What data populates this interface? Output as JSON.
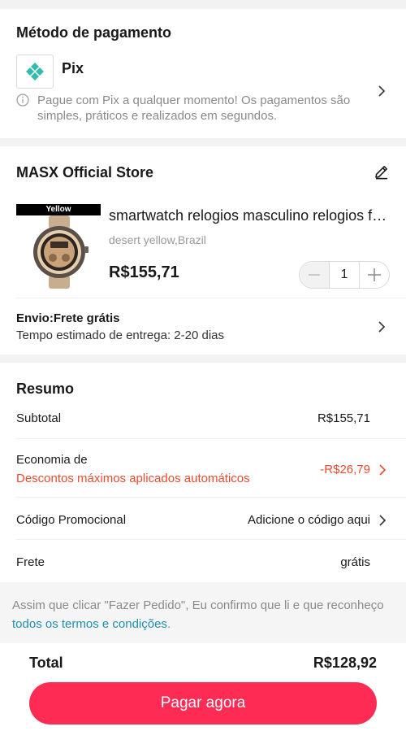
{
  "payment": {
    "title": "Método de pagamento",
    "method": "Pix",
    "note": "Pague com Pix a qualquer momento! Os pagamentos são simples, práticos e realizados em segundos."
  },
  "store": {
    "name": "MASX Official Store",
    "product": {
      "badge": "Yellow",
      "title": "smartwatch relogios masculino relogios femininos",
      "variant": "desert yellow,Brazil",
      "price": "R$155,71",
      "quantity": "1"
    },
    "shipping": {
      "title": "Envio:Frete grátis",
      "eta": "Tempo estimado de entrega: 2-20 dias"
    }
  },
  "summary": {
    "title": "Resumo",
    "subtotal_label": "Subtotal",
    "subtotal_value": "R$155,71",
    "savings_label": "Economia de",
    "savings_sub": "Descontos máximos aplicados automáticos",
    "savings_value": "-R$26,79",
    "promo_label": "Código Promocional",
    "promo_value": "Adicione o código aqui",
    "shipping_label": "Frete",
    "shipping_value": "grátis"
  },
  "terms": {
    "text": "Assim que clicar \"Fazer Pedido\", Eu confirmo que li e que reconheço ",
    "link": "todos os termos e condições",
    "end": "."
  },
  "footer": {
    "total_label": "Total",
    "total_value": "R$128,92",
    "pay_button": "Pagar agora"
  },
  "colors": {
    "accent": "#fe2c55",
    "discount": "#e94b2f",
    "link": "#1f8fb0",
    "pix": "#32bcad"
  }
}
